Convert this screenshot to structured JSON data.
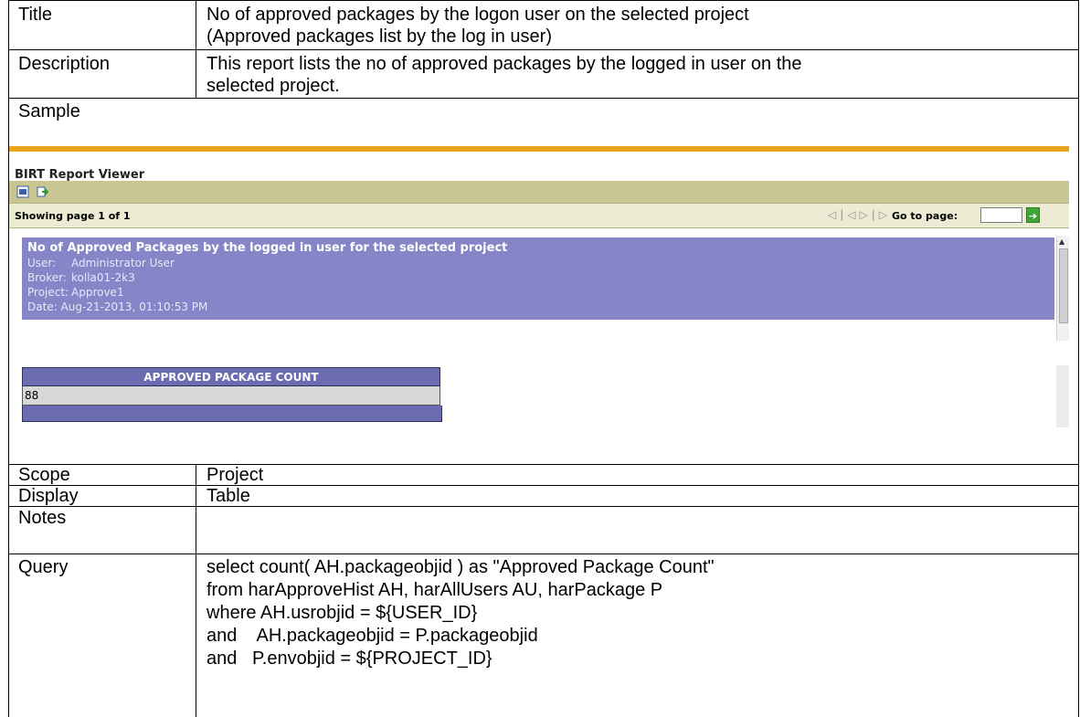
{
  "rows": {
    "title": {
      "label": "Title",
      "line1": "No of approved packages by the logon user on the selected project",
      "line2": "(Approved packages list by the log in user)"
    },
    "description": {
      "label": "Description",
      "line1": "This report lists the no of approved packages by the logged in user on the",
      "line2": "selected project."
    },
    "sample": {
      "label": "Sample"
    },
    "scope": {
      "label": "Scope",
      "value": "Project"
    },
    "display": {
      "label": "Display",
      "value": "Table"
    },
    "notes": {
      "label": "Notes",
      "value": ""
    },
    "query": {
      "label": "Query",
      "lines": [
        "select count( AH.packageobjid ) as \"Approved Package Count\"",
        "from harApproveHist AH, harAllUsers AU, harPackage P",
        "where AH.usrobjid = ${USER_ID}",
        "and    AH.packageobjid = P.packageobjid",
        "and   P.envobjid = ${PROJECT_ID}"
      ]
    }
  },
  "viewer": {
    "title": "BIRT Report Viewer",
    "toolbar_icons": [
      "pdf-export-icon",
      "data-export-icon"
    ],
    "showing": "Showing page  1  of  1",
    "nav_icons": [
      "first-page-icon",
      "previous-page-icon",
      "next-page-icon",
      "last-page-icon"
    ],
    "goto_label": "Go to page:",
    "goto_value": "",
    "report": {
      "title": "No of Approved Packages by the logged in user for the selected project",
      "user_label": "User:",
      "user_value": "Administrator User",
      "broker_label": "Broker:",
      "broker_value": "kolla01-2k3",
      "project_label": "Project:",
      "project_value": "Approve1",
      "date": "Date: Aug-21-2013, 01:10:53 PM"
    },
    "table": {
      "header": "APPROVED PACKAGE COUNT",
      "value": "88"
    },
    "colors": {
      "accent_bar": "#e8a61b",
      "panel": "#8585c8",
      "table_header": "#6b6bb2",
      "toolbar": "#c9c692"
    }
  }
}
